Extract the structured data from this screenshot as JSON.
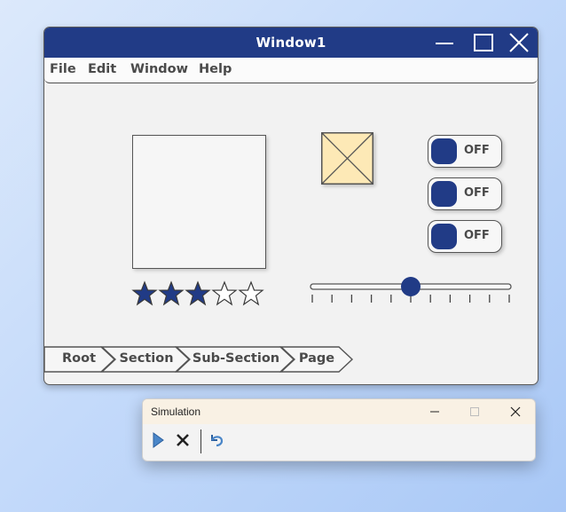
{
  "window": {
    "title": "Window1",
    "controls": [
      "minimize-icon",
      "maximize-icon",
      "close-icon"
    ]
  },
  "menu": {
    "items": [
      "File",
      "Edit",
      "Window",
      "Help"
    ]
  },
  "image_placeholder": {
    "icon": "image-placeholder-icon",
    "fill": "#fde9b6"
  },
  "rating": {
    "value": 3,
    "max": 5,
    "color": "#213b86"
  },
  "slider": {
    "value": 0.5,
    "ticks": 11
  },
  "toggles": [
    {
      "label": "OFF"
    },
    {
      "label": "OFF"
    },
    {
      "label": "OFF"
    }
  ],
  "breadcrumb": {
    "items": [
      "Root",
      "Section",
      "Sub-Section",
      "Page"
    ]
  },
  "simulation": {
    "title": "Simulation",
    "tools": [
      "play-icon",
      "stop-icon",
      "undo-icon"
    ]
  },
  "colors": {
    "accent": "#213b86",
    "window_bg": "#f2f2f2",
    "sim_title_bg": "#f9f1e4"
  }
}
